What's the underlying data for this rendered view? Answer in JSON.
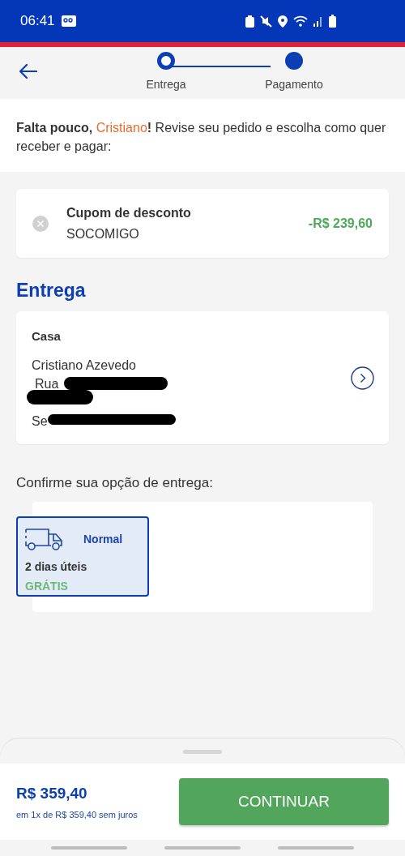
{
  "status_bar": {
    "time": "06:41"
  },
  "stepper": {
    "steps": [
      {
        "label": "Entrega",
        "selected": true
      },
      {
        "label": "Pagamento",
        "selected": false
      }
    ]
  },
  "intro": {
    "greeting": "Falta pouco, ",
    "name": "Cristiano",
    "text": "**!** Revise seu pedido e escolha como quer receber e pagar:"
  },
  "coupon": {
    "title": "Cupom de desconto",
    "code": "SOCOMIGO",
    "amount": "-R$ 239,60"
  },
  "delivery": {
    "heading": "Entrega",
    "address": {
      "label": "Casa",
      "lines": [
        {
          "text": "Cristiano Azevedo",
          "redacted": false
        },
        {
          "text": "Rua",
          "redacted": true
        },
        {
          "redacted": true
        },
        {
          "text": "Se",
          "redacted": true
        }
      ]
    },
    "prompt": "Confirme sua opção de entrega:",
    "options": [
      {
        "name": "Normal",
        "time": "2 dias úteis",
        "price": "GRÁTIS",
        "selected": true
      }
    ]
  },
  "footer": {
    "total": "R$ 359,40",
    "installments": "em 1x de R$ 359,40 sem juros",
    "button": "CONTINUAR"
  }
}
